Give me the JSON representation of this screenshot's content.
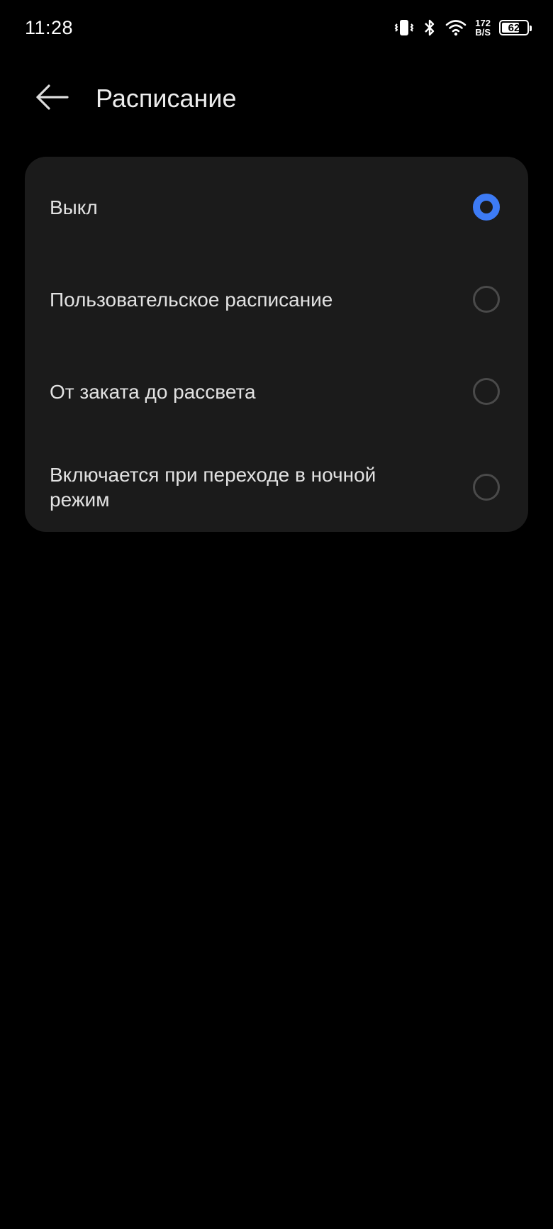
{
  "status_bar": {
    "time": "11:28",
    "net_speed_value": "172",
    "net_speed_unit": "B/S",
    "battery_level": "62",
    "icons": [
      "vibrate-icon",
      "bluetooth-icon",
      "wifi-icon",
      "battery-icon"
    ]
  },
  "header": {
    "back_icon": "arrow-left-icon",
    "title": "Расписание"
  },
  "options": [
    {
      "label": "Выкл",
      "selected": true
    },
    {
      "label": "Пользовательское расписание",
      "selected": false
    },
    {
      "label": "От заката до рассвета",
      "selected": false
    },
    {
      "label": "Включается при переходе в ночной режим",
      "selected": false
    }
  ],
  "colors": {
    "accent": "#3d7bf5",
    "card_background": "#1b1b1b",
    "page_background": "#000000"
  }
}
